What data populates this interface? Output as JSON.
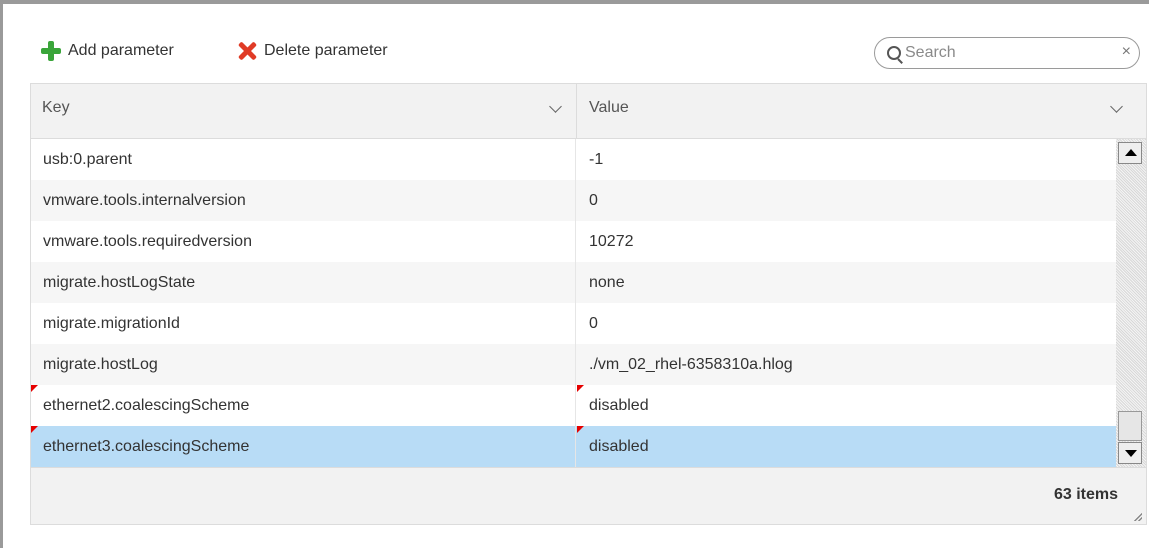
{
  "toolbar": {
    "add_label": "Add parameter",
    "delete_label": "Delete parameter",
    "search_placeholder": "Search",
    "clear_icon": "×"
  },
  "grid": {
    "columns": [
      {
        "label": "Key"
      },
      {
        "label": "Value"
      }
    ],
    "rows": [
      {
        "key": "usb:0.parent",
        "value": "-1"
      },
      {
        "key": "vmware.tools.internalversion",
        "value": "0"
      },
      {
        "key": "vmware.tools.requiredversion",
        "value": "10272"
      },
      {
        "key": "migrate.hostLogState",
        "value": "none"
      },
      {
        "key": "migrate.migrationId",
        "value": "0"
      },
      {
        "key": "migrate.hostLog",
        "value": "./vm_02_rhel-6358310a.hlog"
      },
      {
        "key": "ethernet2.coalescingScheme",
        "value": "disabled",
        "modified": true
      },
      {
        "key": "ethernet3.coalescingScheme",
        "value": "disabled",
        "modified": true,
        "selected": true
      }
    ],
    "footer_count": "63 items"
  },
  "colors": {
    "selected_row": "#b8dcf6",
    "modified_flag": "#e60000",
    "add_icon": "#3aa53a",
    "delete_icon": "#e03b26"
  }
}
